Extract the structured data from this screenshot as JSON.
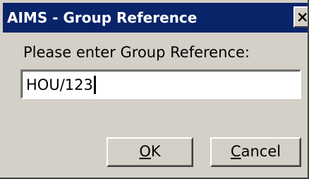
{
  "window": {
    "title": "AIMS - Group Reference",
    "close_icon": "close-icon",
    "close_glyph": "×"
  },
  "form": {
    "prompt": "Please enter Group Reference:",
    "value": "HOU/123"
  },
  "buttons": {
    "ok": {
      "mnemonic": "O",
      "rest": "K"
    },
    "cancel": {
      "mnemonic": "C",
      "rest": "ancel"
    }
  },
  "colors": {
    "titlebar": "#0a246a",
    "face": "#d4d0c8",
    "title_text": "#ffffff"
  }
}
